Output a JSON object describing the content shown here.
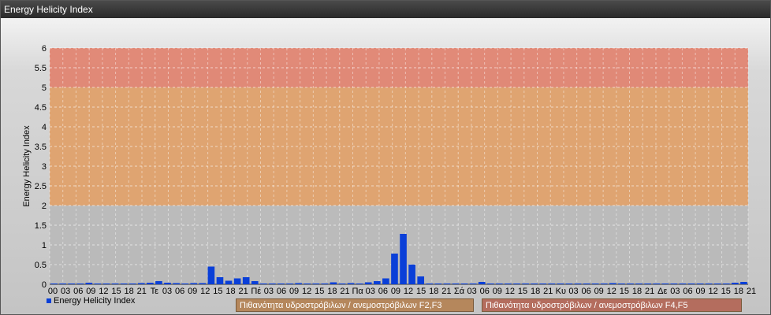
{
  "window": {
    "title": "Energy Helicity Index"
  },
  "legend": {
    "series_label": "Energy Helicity Index"
  },
  "bands": {
    "label_low": "Πιθανότητα υδροστρόβιλων / ανεμοστρόβιλων F2,F3",
    "label_high": "Πιθανότητα υδροστρόβιλων / ανεμοστρόβιλων F4,F5",
    "colors": {
      "grey": "#b9b9b9",
      "orange": "#dfa16c",
      "red": "#e08572",
      "label_low_bg": "#b5875c",
      "label_high_bg": "#b46d5e"
    },
    "ranges": [
      [
        0,
        2
      ],
      [
        2,
        5
      ],
      [
        5,
        6
      ]
    ]
  },
  "chart_data": {
    "type": "bar",
    "title": "",
    "xlabel": "",
    "ylabel": "Energy Helicity Index",
    "ylim": [
      0,
      6
    ],
    "yticks": [
      "0",
      "0.5",
      "1",
      "1.5",
      "2",
      "2.5",
      "3",
      "3.5",
      "4",
      "4.5",
      "5",
      "5.5",
      "6"
    ],
    "grid": true,
    "legend_position": "bottom-left",
    "bar_color": "#0a3fd8",
    "categories": [
      "00",
      "03",
      "06",
      "09",
      "12",
      "15",
      "18",
      "21",
      "Τε",
      "03",
      "06",
      "09",
      "12",
      "15",
      "18",
      "21",
      "Πέ",
      "03",
      "06",
      "09",
      "12",
      "15",
      "18",
      "21",
      "Πα",
      "03",
      "06",
      "09",
      "12",
      "15",
      "18",
      "21",
      "Σά",
      "03",
      "06",
      "09",
      "12",
      "15",
      "18",
      "21",
      "Κυ",
      "03",
      "06",
      "09",
      "12",
      "15",
      "18",
      "21",
      "Δε",
      "03",
      "06",
      "09",
      "12",
      "15",
      "18",
      "21"
    ],
    "series": [
      {
        "name": "Energy Helicity Index",
        "values": [
          0.02,
          0.02,
          0.02,
          0.02,
          0.04,
          0.02,
          0.02,
          0.02,
          0.02,
          0.02,
          0.03,
          0.04,
          0.08,
          0.04,
          0.03,
          0.02,
          0.03,
          0.03,
          0.45,
          0.18,
          0.09,
          0.15,
          0.18,
          0.08,
          0.02,
          0.02,
          0.02,
          0.02,
          0.03,
          0.02,
          0.02,
          0.02,
          0.05,
          0.02,
          0.03,
          0.02,
          0.05,
          0.08,
          0.15,
          0.78,
          1.28,
          0.5,
          0.2,
          0.02,
          0.02,
          0.02,
          0.02,
          0.02,
          0.02,
          0.06,
          0.02,
          0.02,
          0.02,
          0.02,
          0.02,
          0.02,
          0.02,
          0.02,
          0.02,
          0.02,
          0.02,
          0.02,
          0.02,
          0.02,
          0.03,
          0.02,
          0.02,
          0.02,
          0.02,
          0.02,
          0.02,
          0.02,
          0.02,
          0.02,
          0.02,
          0.02,
          0.02,
          0.02,
          0.04,
          0.06
        ]
      }
    ]
  }
}
